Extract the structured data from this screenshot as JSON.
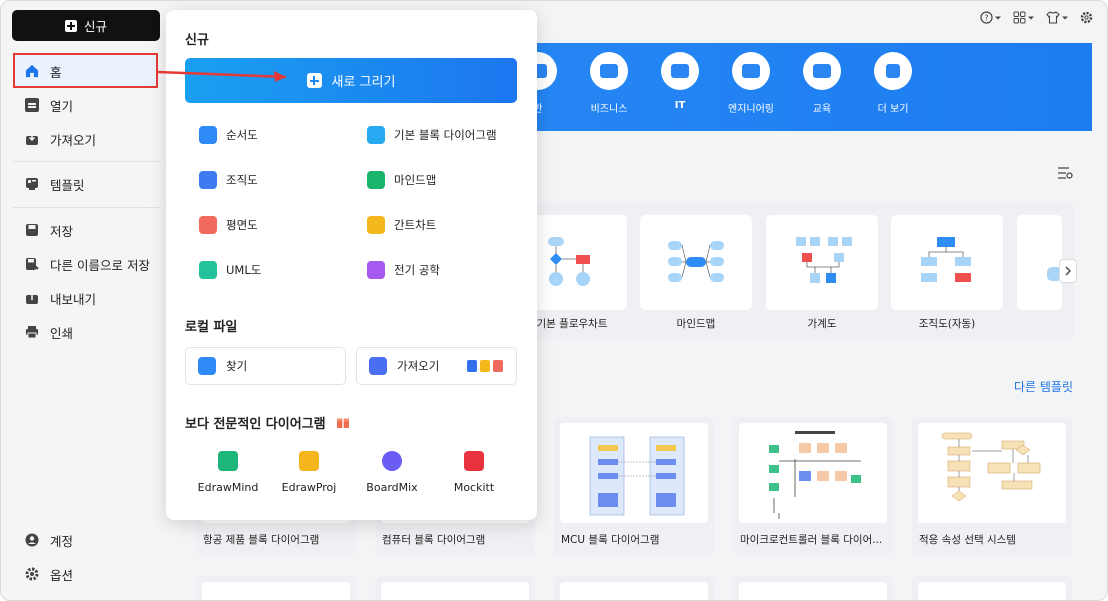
{
  "sidebar": {
    "new_label": "신규",
    "items": [
      {
        "label": "홈"
      },
      {
        "label": "열기"
      },
      {
        "label": "가져오기"
      },
      {
        "label": "템플릿"
      },
      {
        "label": "저장"
      },
      {
        "label": "다른 이름으로 저장"
      },
      {
        "label": "내보내기"
      },
      {
        "label": "인쇄"
      }
    ],
    "bottom": [
      {
        "label": "계정"
      },
      {
        "label": "옵션"
      }
    ]
  },
  "banner": {
    "categories": [
      {
        "label": "반"
      },
      {
        "label": "비즈니스"
      },
      {
        "label": "IT"
      },
      {
        "label": "엔지니어링"
      },
      {
        "label": "교육"
      },
      {
        "label": "더 보기"
      }
    ]
  },
  "templates": {
    "row": [
      {
        "label": "기본 플로우차트"
      },
      {
        "label": "마인드맵"
      },
      {
        "label": "가계도"
      },
      {
        "label": "조직도(자동)"
      }
    ],
    "more_link": "다른 템플릿",
    "grid": [
      {
        "label": "항공 제품 블록 다이어그램"
      },
      {
        "label": "컴퓨터 블록 다이어그램"
      },
      {
        "label": "MCU 블록 다이어그램"
      },
      {
        "label": "마이크로컨트롤러 블록 다이어..."
      },
      {
        "label": "적응 속성 선택 시스템"
      }
    ]
  },
  "panel": {
    "title": "신규",
    "draw_button": "새로 그리기",
    "diagrams": [
      {
        "label": "순서도",
        "color": "#2f8af5"
      },
      {
        "label": "기본 블록 다이어그램",
        "color": "#27a8f0"
      },
      {
        "label": "조직도",
        "color": "#3d7cf0"
      },
      {
        "label": "마인드맵",
        "color": "#19b36b"
      },
      {
        "label": "평면도",
        "color": "#f06a5e"
      },
      {
        "label": "간트차트",
        "color": "#f5b81c"
      },
      {
        "label": "UML도",
        "color": "#22c29a"
      },
      {
        "label": "전기 공학",
        "color": "#a65af0"
      }
    ],
    "local_title": "로컬 파일",
    "find_label": "찾기",
    "import_label": "가져오기",
    "pro_title": "보다 전문적인 다이어그램",
    "apps": [
      {
        "label": "EdrawMind",
        "color": "#1fb67c"
      },
      {
        "label": "EdrawProj",
        "color": "#f5b51c"
      },
      {
        "label": "BoardMix",
        "color": "#6a5cf5"
      },
      {
        "label": "Mockitt",
        "color": "#e8333f"
      }
    ]
  }
}
